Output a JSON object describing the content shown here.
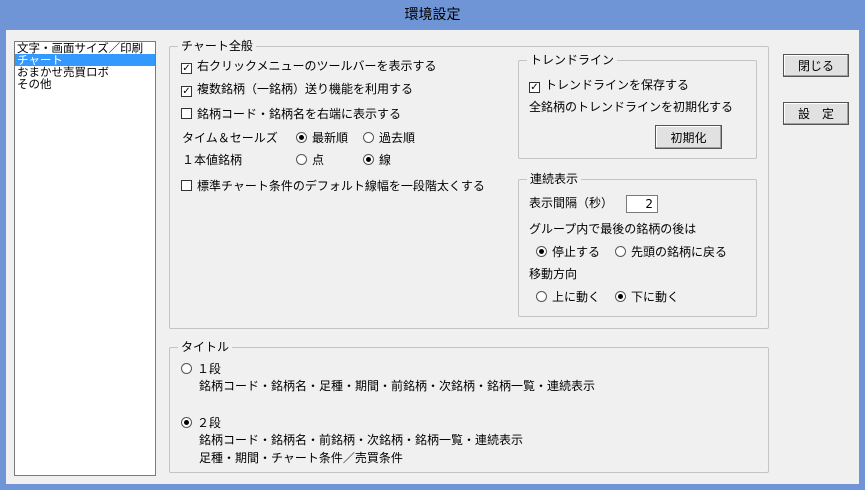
{
  "window": {
    "title": "環境設定"
  },
  "sidebar": {
    "items": [
      {
        "label": "文字・画面サイズ／印刷",
        "selected": false
      },
      {
        "label": "チャート",
        "selected": true
      },
      {
        "label": "おまかせ売買ロボ",
        "selected": false
      },
      {
        "label": "その他",
        "selected": false
      }
    ]
  },
  "chart_general": {
    "legend": "チャート全般",
    "opt_toolbar": {
      "label": "右クリックメニューのツールバーを表示する",
      "checked": true
    },
    "opt_multi_send": {
      "label": "複数銘柄（一銘柄）送り機能を利用する",
      "checked": true
    },
    "opt_code_right": {
      "label": "銘柄コード・銘柄名を右端に表示する",
      "checked": false
    },
    "time_sales": {
      "label": "タイム＆セールズ",
      "opt_newest": "最新順",
      "opt_oldest": "過去順",
      "selected": "newest"
    },
    "single_price": {
      "label": "１本値銘柄",
      "opt_dot": "点",
      "opt_line": "線",
      "selected": "line"
    },
    "opt_thick_line": {
      "label": "標準チャート条件のデフォルト線幅を一段階太くする",
      "checked": false
    }
  },
  "trendline": {
    "legend": "トレンドライン",
    "save": {
      "label": "トレンドラインを保存する",
      "checked": true
    },
    "init_text": "全銘柄のトレンドラインを初期化する",
    "init_button": "初期化"
  },
  "continuous": {
    "legend": "連続表示",
    "interval_label": "表示間隔（秒）",
    "interval_value": "2",
    "after_last_label": "グループ内で最後の銘柄の後は",
    "opt_stop": "停止する",
    "opt_return": "先頭の銘柄に戻る",
    "after_last_selected": "stop",
    "direction_label": "移動方向",
    "opt_up": "上に動く",
    "opt_down": "下に動く",
    "direction_selected": "down"
  },
  "title_group": {
    "legend": "タイトル",
    "opt1_label": "１段",
    "opt1_desc": "銘柄コード・銘柄名・足種・期間・前銘柄・次銘柄・銘柄一覧・連続表示",
    "opt2_label": "２段",
    "opt2_desc_line1": "銘柄コード・銘柄名・前銘柄・次銘柄・銘柄一覧・連続表示",
    "opt2_desc_line2": "足種・期間・チャート条件／売買条件",
    "selected": "two"
  },
  "buttons": {
    "close": "閉じる",
    "settings": "設　定"
  }
}
